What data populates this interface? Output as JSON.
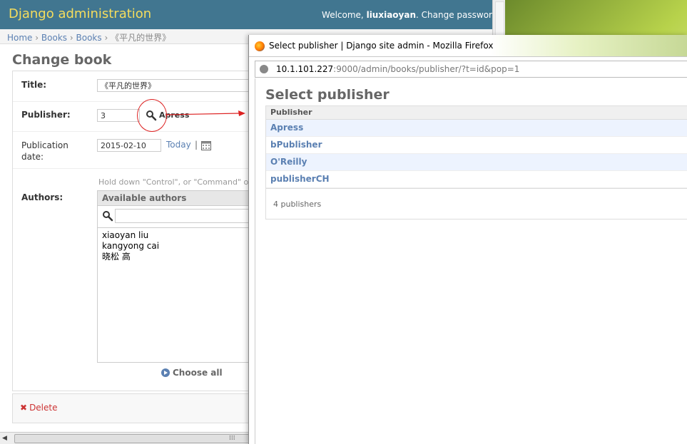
{
  "header": {
    "branding": "Django administration",
    "welcome": "Welcome,",
    "username": "liuxiaoyan",
    "change_password": "Change passwor"
  },
  "breadcrumbs": {
    "home": "Home",
    "books": "Books",
    "books2": "Books",
    "current": "《平凡的世界》",
    "sep": "›"
  },
  "form": {
    "page_title": "Change book",
    "title_label": "Title:",
    "title_value": "《平凡的世界》",
    "publisher_label": "Publisher:",
    "publisher_id": "3",
    "publisher_name": "Apress",
    "pubdate_label_1": "Publication",
    "pubdate_label_2": "date:",
    "pubdate_value": "2015-02-10",
    "today_link": "Today",
    "today_sep": "|",
    "help_text": "Hold down \"Control\", or \"Command\" o",
    "authors_label": "Authors:",
    "available_title": "Available authors",
    "authors": [
      "xiaoyan liu",
      "kangyong cai",
      "晓松 高"
    ],
    "choose_all": "Choose all",
    "delete": "Delete",
    "delete_icon": "✖"
  },
  "popup": {
    "window_title": "Select publisher | Django site admin - Mozilla Firefox",
    "url_host": "10.1.101.227",
    "url_path": ":9000/admin/books/publisher/?t=id&pop=1",
    "heading": "Select publisher",
    "column_header": "Publisher",
    "publishers": [
      "Apress",
      "bPublisher",
      "O'Reilly",
      "publisherCH"
    ],
    "count_text": "4 publishers"
  },
  "colors": {
    "header_bg": "#417690",
    "branding": "#f5dd5d",
    "link": "#5b80b2",
    "annotation_red": "#dd2222"
  },
  "icons": [
    "magnifier-icon",
    "calendar-icon",
    "choose-all-icon",
    "delete-icon",
    "firefox-icon",
    "globe-icon"
  ]
}
